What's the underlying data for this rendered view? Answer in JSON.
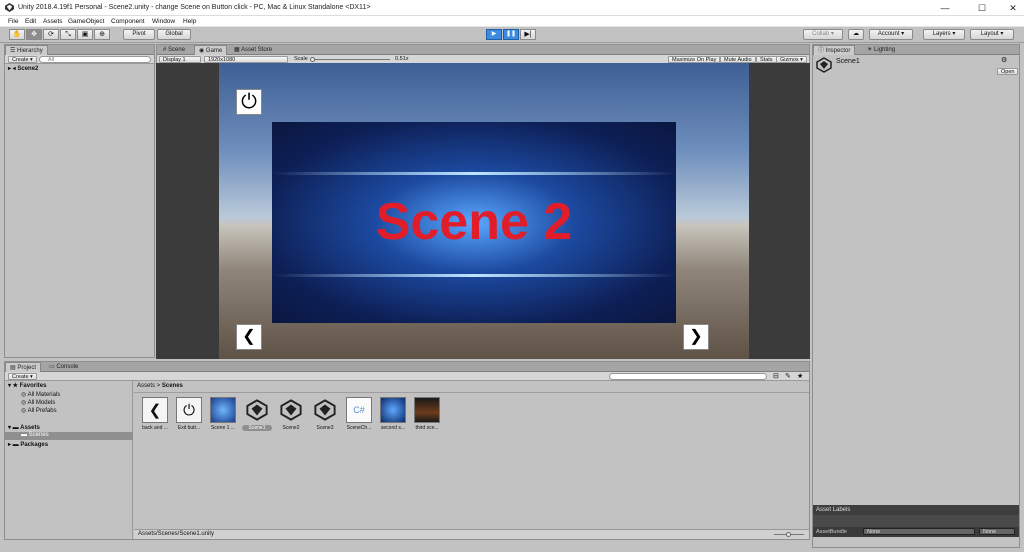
{
  "window": {
    "title": "Unity 2018.4.19f1 Personal - Scene2.unity - change Scene on Button click - PC, Mac & Linux Standalone <DX11>",
    "controls": [
      "—",
      "☐",
      "✕"
    ]
  },
  "menu": [
    "File",
    "Edit",
    "Assets",
    "GameObject",
    "Component",
    "Window",
    "Help"
  ],
  "toolbar": {
    "pivot": "Pivot",
    "global": "Global",
    "collab": "Collab ▾",
    "account": "Account",
    "layers": "Layers",
    "layout": "Layout"
  },
  "hierarchy": {
    "tab": "Hierarchy",
    "create": "Create ▾",
    "search_placeholder": "All",
    "scene": "Scene2"
  },
  "center": {
    "tabs": [
      "Scene",
      "Game",
      "Asset Store"
    ],
    "display": "Display 1",
    "resolution": "1920x1080",
    "scale_label": "Scale",
    "scale_value": "0.51x",
    "options": [
      "Maximize On Play",
      "Mute Audio",
      "Stats",
      "Gizmos ▾"
    ]
  },
  "game": {
    "scene_text": "Scene 2",
    "power_icon": "⏻",
    "left_icon": "❮",
    "right_icon": "❯"
  },
  "inspector": {
    "tabs": [
      "Inspector",
      "Lighting"
    ],
    "object": "Scene1",
    "open": "Open",
    "asset_labels": "Asset Labels",
    "asset_bundle": "AssetBundle",
    "none1": "None",
    "none2": "None"
  },
  "project": {
    "tabs": [
      "Project",
      "Console"
    ],
    "create": "Create ▾",
    "favorites": "Favorites",
    "fav_items": [
      "All Materials",
      "All Models",
      "All Prefabs"
    ],
    "assets": "Assets",
    "scenes": "Scenes",
    "packages": "Packages",
    "breadcrumb_assets": "Assets",
    "breadcrumb_scenes": "Scenes",
    "path": "Assets/Scenes/Scene1.unity",
    "items": [
      {
        "label": "back and ...",
        "kind": "back"
      },
      {
        "label": "Exit butt...",
        "kind": "power"
      },
      {
        "label": "Scene 1 ...",
        "kind": "image"
      },
      {
        "label": "Scene1",
        "kind": "unity"
      },
      {
        "label": "Scene2",
        "kind": "unity"
      },
      {
        "label": "Scene3",
        "kind": "unity"
      },
      {
        "label": "SceneCh...",
        "kind": "cs"
      },
      {
        "label": "second s...",
        "kind": "image2"
      },
      {
        "label": "third sce...",
        "kind": "image3"
      }
    ]
  }
}
